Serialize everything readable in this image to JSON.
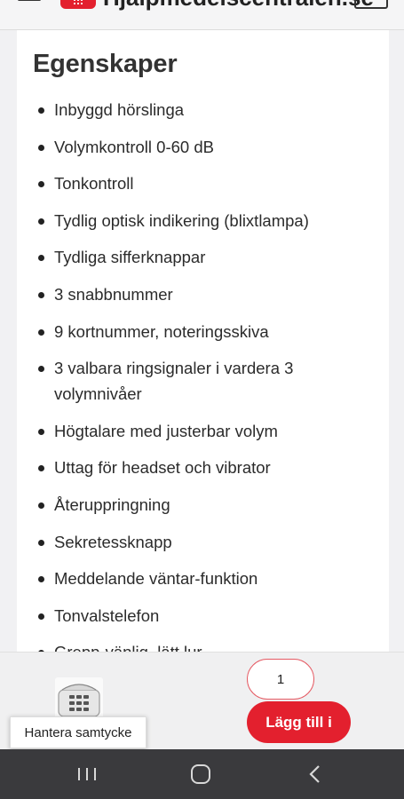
{
  "header": {
    "site_name": "Hjälpmedelscentralen.se",
    "icons": [
      "menu-icon",
      "logo-icon",
      "cart-icon"
    ]
  },
  "section": {
    "title": "Egenskaper",
    "features": [
      "Inbyggd hörslinga",
      "Volymkontroll 0-60 dB",
      "Tonkontroll",
      "Tydlig optisk indikering (blixtlampa)",
      "Tydliga sifferknappar",
      "3 snabbnummer",
      "9 kortnummer, noteringsskiva",
      "3 valbara ringsignaler i vardera 3 volymnivåer",
      "Högtalare med justerbar volym",
      "Uttag för headset och vibrator",
      "Återuppringning",
      "Sekretessknapp",
      "Meddelande väntar-funktion",
      "Tonvalstelefon",
      "Grepp-vänlig, lätt lur"
    ]
  },
  "cart_bar": {
    "quantity_value": "1",
    "add_button_label": "Lägg till i",
    "consent_label": "Hantera samtycke",
    "product_image": "telephone-product-icon"
  },
  "system_nav": {
    "icons": [
      "recents-icon",
      "home-icon",
      "back-icon"
    ]
  },
  "colors": {
    "accent": "#e3202e",
    "nav_bar": "#3a3a3d",
    "background": "#f1f1f3"
  }
}
